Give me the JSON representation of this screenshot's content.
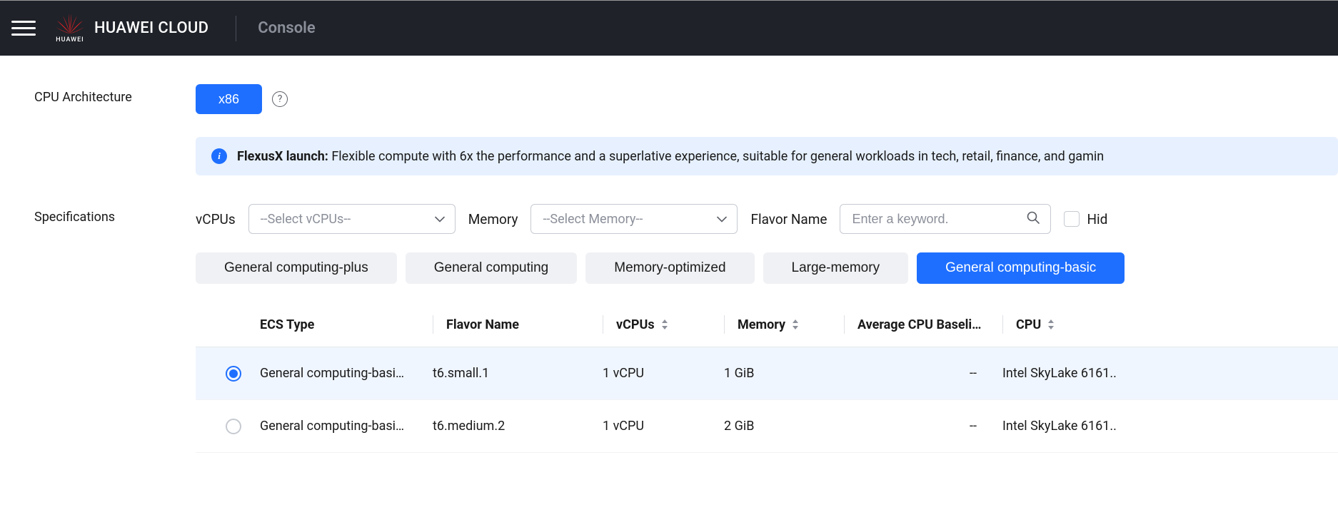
{
  "header": {
    "brand": "HUAWEI CLOUD",
    "logo_subtext": "HUAWEI",
    "console": "Console"
  },
  "architecture": {
    "label": "CPU Architecture",
    "selected": "x86"
  },
  "banner": {
    "title": "FlexusX launch:",
    "text": "Flexible compute with 6x the performance and a superlative experience, suitable for general workloads in tech, retail, finance, and gamin"
  },
  "specifications": {
    "label": "Specifications",
    "vcpus_label": "vCPUs",
    "vcpus_placeholder": "--Select vCPUs--",
    "memory_label": "Memory",
    "memory_placeholder": "--Select Memory--",
    "flavor_label": "Flavor Name",
    "search_placeholder": "Enter a keyword.",
    "hide_label": "Hid"
  },
  "tabs": [
    {
      "label": "General computing-plus",
      "active": false
    },
    {
      "label": "General computing",
      "active": false
    },
    {
      "label": "Memory-optimized",
      "active": false
    },
    {
      "label": "Large-memory",
      "active": false
    },
    {
      "label": "General computing-basic",
      "active": true
    }
  ],
  "table": {
    "headers": {
      "ecs_type": "ECS Type",
      "flavor_name": "Flavor Name",
      "vcpus": "vCPUs",
      "memory": "Memory",
      "baseline": "Average CPU Baseli…",
      "cpu": "CPU"
    },
    "rows": [
      {
        "selected": true,
        "ecs_type": "General computing-basi…",
        "flavor_name": "t6.small.1",
        "vcpus": "1 vCPU",
        "memory": "1 GiB",
        "baseline": "--",
        "cpu": "Intel SkyLake 6161.."
      },
      {
        "selected": false,
        "ecs_type": "General computing-basi…",
        "flavor_name": "t6.medium.2",
        "vcpus": "1 vCPU",
        "memory": "2 GiB",
        "baseline": "--",
        "cpu": "Intel SkyLake 6161.."
      }
    ]
  }
}
